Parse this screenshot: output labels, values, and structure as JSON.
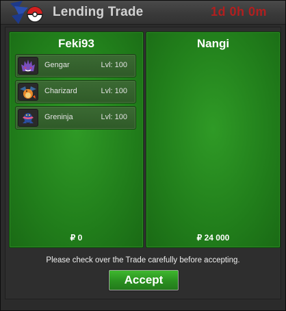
{
  "window": {
    "title": "Lending Trade",
    "timer": "1d 0h 0m"
  },
  "panels": [
    {
      "name": "Feki93",
      "pokemon": [
        {
          "name": "Gengar",
          "level": "Lvl: 100",
          "sprite": "gengar-sprite-icon"
        },
        {
          "name": "Charizard",
          "level": "Lvl: 100",
          "sprite": "charizard-sprite-icon"
        },
        {
          "name": "Greninja",
          "level": "Lvl: 100",
          "sprite": "greninja-sprite-icon"
        }
      ],
      "money": "₽ 0"
    },
    {
      "name": "Nangi",
      "pokemon": [],
      "money": "₽ 24 000"
    }
  ],
  "footer": {
    "notice": "Please check over the Trade carefully before accepting.",
    "accept_label": "Accept"
  },
  "colors": {
    "panel_green": "#217e1b",
    "timer_red": "#b21f1f",
    "button_green": "#2a9020"
  }
}
